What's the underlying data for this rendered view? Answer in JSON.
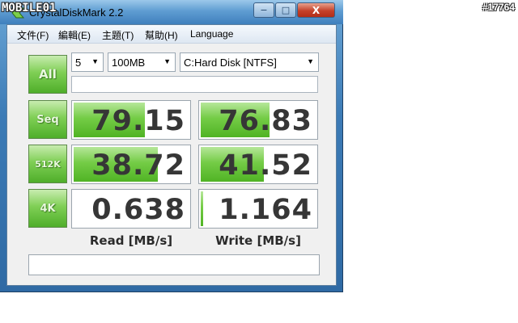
{
  "window": {
    "title": "CrystalDiskMark 2.2",
    "controls": {
      "minimize": "−",
      "maximize": "□",
      "close": "X"
    }
  },
  "watermark": "MOBILE01",
  "post_id": "#17764",
  "menu": {
    "items": [
      {
        "label": "文件(F)"
      },
      {
        "label": "編輯(E)"
      },
      {
        "label": "主題(T)"
      },
      {
        "label": "幫助(H)"
      },
      {
        "label": "Language"
      }
    ]
  },
  "controls": {
    "all_button": "All",
    "runs": "5",
    "size": "100MB",
    "drive": "C:Hard Disk [NTFS]",
    "status": ""
  },
  "results": {
    "rows": [
      {
        "label": "Seq",
        "read": "79.15",
        "write": "76.83",
        "read_level": 0.62,
        "write_level": 0.6
      },
      {
        "label": "512K",
        "read": "38.72",
        "write": "41.52",
        "read_level": 0.73,
        "write_level": 0.55
      },
      {
        "label": "4K",
        "read": "0.638",
        "write": "1.164",
        "read_level": 0.0,
        "write_level": 0.01
      }
    ],
    "read_header": "Read [MB/s]",
    "write_header": "Write [MB/s]"
  },
  "comment": "",
  "colors": {
    "accent_green": "#74cc46",
    "title_blue": "#5f9dd2",
    "close_red": "#c4412a"
  }
}
